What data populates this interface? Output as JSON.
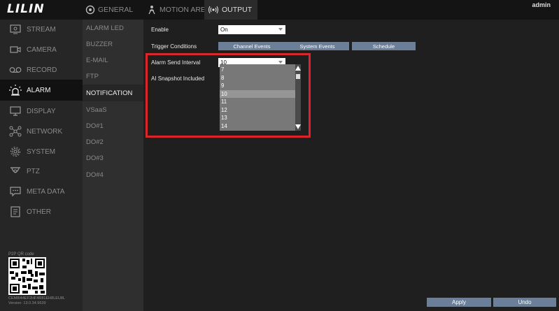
{
  "topbar": {
    "logo": "LILIN",
    "tabs": [
      {
        "label": "GENERAL",
        "icon": "general-icon"
      },
      {
        "label": "MOTION AREA",
        "icon": "motion-area-icon"
      },
      {
        "label": "OUTPUT",
        "icon": "output-icon"
      }
    ],
    "user": "admin"
  },
  "sidebar": {
    "items": [
      {
        "label": "STREAM",
        "icon": "stream-icon"
      },
      {
        "label": "CAMERA",
        "icon": "camera-icon"
      },
      {
        "label": "RECORD",
        "icon": "record-icon"
      },
      {
        "label": "ALARM",
        "icon": "alarm-icon"
      },
      {
        "label": "DISPLAY",
        "icon": "display-icon"
      },
      {
        "label": "NETWORK",
        "icon": "network-icon"
      },
      {
        "label": "SYSTEM",
        "icon": "system-icon"
      },
      {
        "label": "PTZ",
        "icon": "ptz-icon"
      },
      {
        "label": "META DATA",
        "icon": "metadata-icon"
      },
      {
        "label": "OTHER",
        "icon": "other-icon"
      }
    ],
    "qr_label": "P2P QR code",
    "device_id": "CEM8I44EF2HF4R81EH8LEU8L",
    "version": "Version: 13.0.34.9639"
  },
  "submenu": {
    "items": [
      "ALARM LED",
      "BUZZER",
      "E-MAIL",
      "FTP",
      "NOTIFICATION",
      "VSaaS",
      "DO#1",
      "DO#2",
      "DO#3",
      "DO#4"
    ]
  },
  "form": {
    "enable_label": "Enable",
    "enable_value": "On",
    "trigger_label": "Trigger Conditions",
    "trigger_buttons": [
      "Channel Events",
      "System Events",
      "Schedule"
    ],
    "interval_label": "Alarm Send Interval",
    "interval_value": "10",
    "snapshot_label": "AI Snapshot Included",
    "interval_options": [
      "7",
      "8",
      "9",
      "10",
      "11",
      "12",
      "13",
      "14"
    ],
    "selected_option": "10"
  },
  "footer": {
    "apply": "Apply",
    "undo": "Undo"
  },
  "colors": {
    "accent_button": "#6b7f99",
    "highlight_border": "#d9262d"
  }
}
